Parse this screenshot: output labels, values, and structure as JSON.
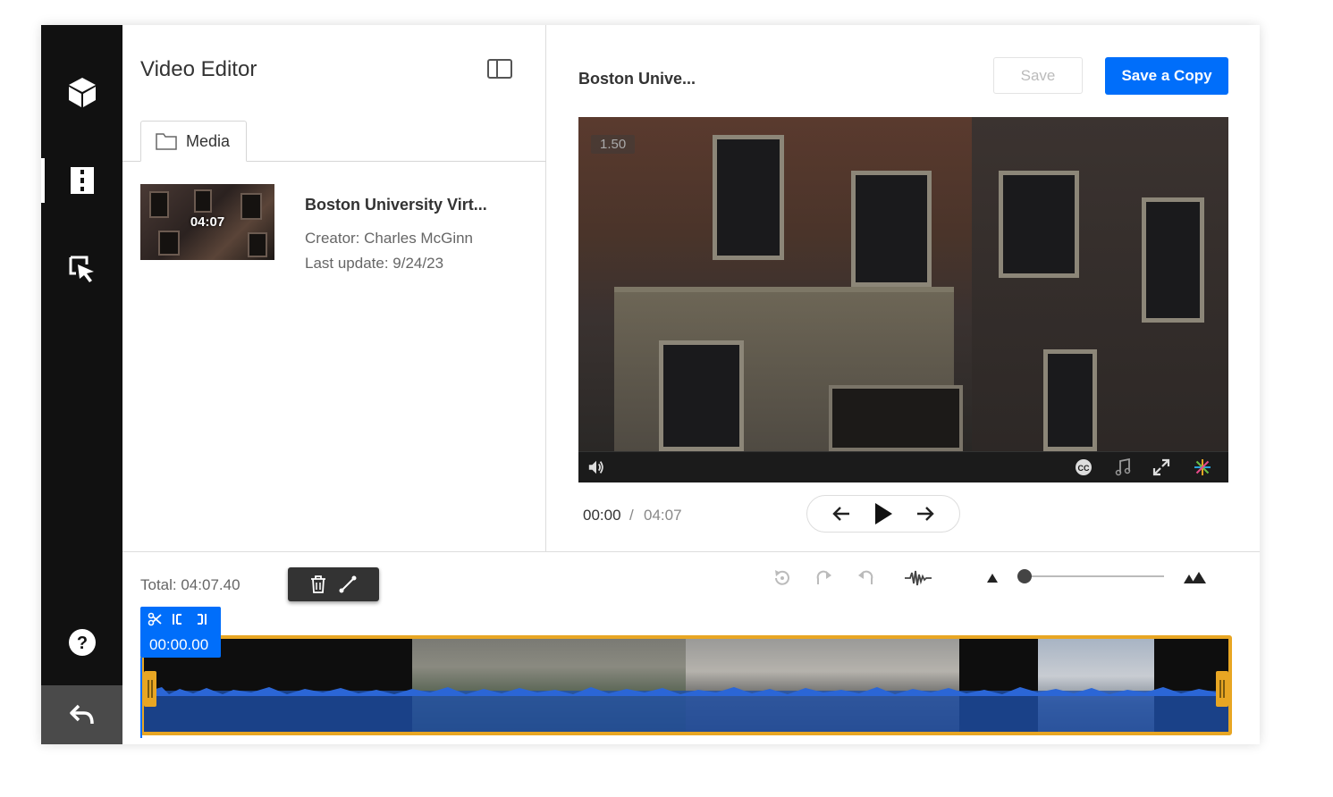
{
  "app": {
    "title": "Video Editor"
  },
  "nav": {
    "items": [
      {
        "icon": "cube-icon"
      },
      {
        "icon": "film-strip-icon",
        "active": true
      },
      {
        "icon": "cursor-click-icon"
      },
      {
        "icon": "help-icon"
      },
      {
        "icon": "undo-back-icon"
      }
    ]
  },
  "left": {
    "tab_label": "Media",
    "media_item": {
      "duration": "04:07",
      "name": "Boston University Virt...",
      "creator": "Creator: Charles McGinn",
      "updated": "Last update: 9/24/23"
    }
  },
  "right": {
    "video_title": "Boston Unive...",
    "save_label": "Save",
    "save_copy_label": "Save a Copy",
    "player": {
      "speed": "1.50",
      "current_time": "00:00",
      "separator": "/",
      "total_time": "04:07"
    }
  },
  "timeline": {
    "total": "Total: 04:07.40",
    "marker_time": "00:00.00",
    "zoom_level": 0.05
  },
  "colors": {
    "accent": "#006efa",
    "clip_border": "#e8a623",
    "nav_bg": "#111111"
  }
}
